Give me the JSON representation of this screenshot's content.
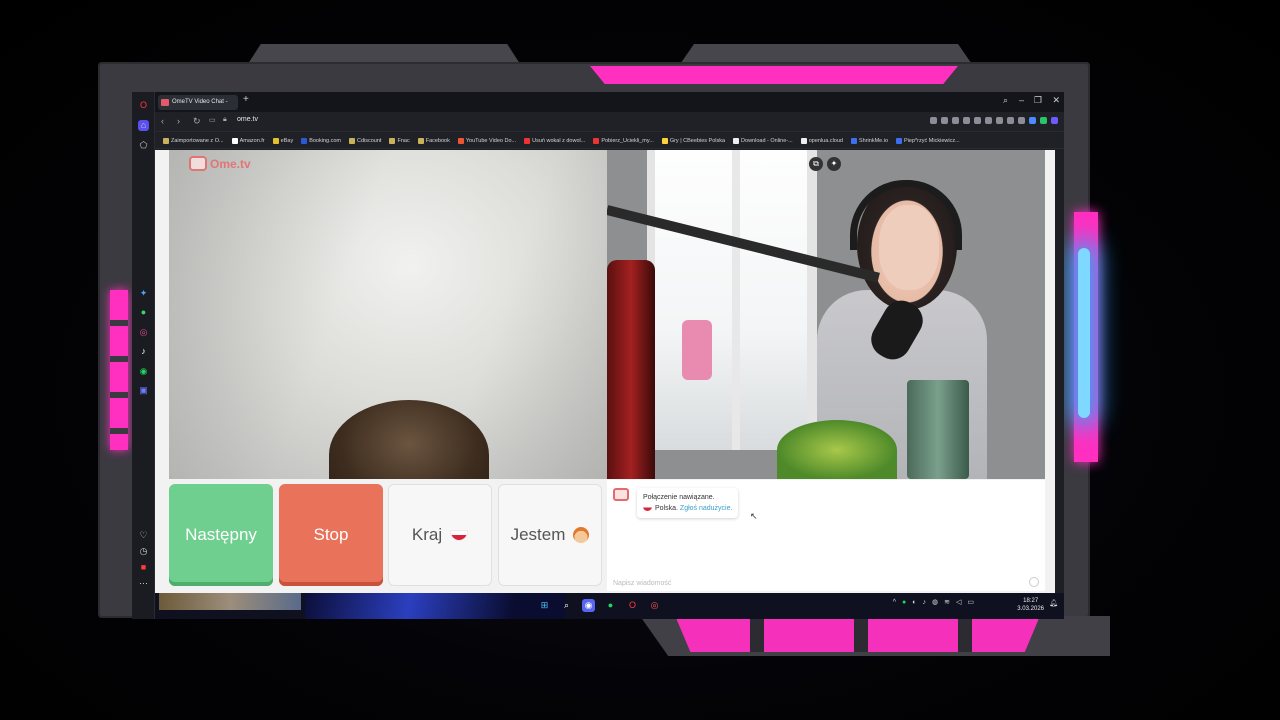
{
  "browser": {
    "tab_title": "OmeTV Video Chat -",
    "url": "ome.tv",
    "bookmarks": [
      "Zaimportowane z O...",
      "Amazon.fr",
      "eBay",
      "Booking.com",
      "Cdiscount",
      "Fnac",
      "Facebook",
      "YouTube Video Do...",
      "Usuń wokal z dowol...",
      "Pobierz_Uciekli_my...",
      "Gry | CBeebies Polska",
      "Download - Online-...",
      "openlua.cloud",
      "ShrinkMe.io",
      "Piep*rzyć Mickiewicz..."
    ]
  },
  "app": {
    "logo_text": "Ome.tv"
  },
  "controls": {
    "next_label": "Następny",
    "stop_label": "Stop",
    "country_label": "Kraj",
    "me_label": "Jestem"
  },
  "chat": {
    "status": "Połączenie nawiązane.",
    "country": "Polska.",
    "report_link": "Zgłoś nadużycie.",
    "input_placeholder": "Napisz wiadomość"
  },
  "taskbar": {
    "time": "18:27",
    "date": "3.03.2026"
  }
}
